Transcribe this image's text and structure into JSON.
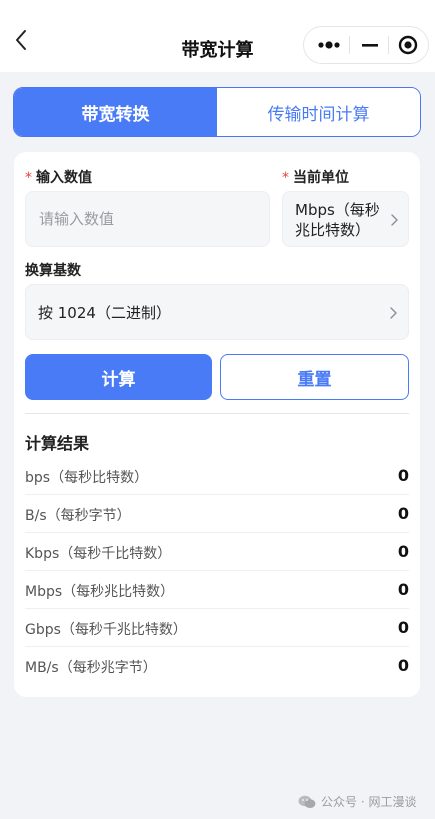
{
  "nav": {
    "title": "带宽计算",
    "back_icon": "chevron-left-icon",
    "capsule": {
      "more_icon": "more-dots-icon",
      "minimize_icon": "minimize-icon",
      "close_icon": "target-icon"
    }
  },
  "tabs": [
    {
      "label": "带宽转换",
      "active": true
    },
    {
      "label": "传输时间计算",
      "active": false
    }
  ],
  "form": {
    "value_field": {
      "required_mark": "*",
      "label": "输入数值",
      "placeholder": "请输入数值",
      "value": ""
    },
    "unit_field": {
      "required_mark": "*",
      "label": "当前单位",
      "selected": "Mbps（每秒兆比特数）"
    },
    "base_field": {
      "label": "换算基数",
      "selected": "按 1024（二进制）"
    }
  },
  "actions": {
    "calculate": "计算",
    "reset": "重置"
  },
  "results": {
    "title": "计算结果",
    "rows": [
      {
        "label": "bps（每秒比特数）",
        "value": "0"
      },
      {
        "label": "B/s（每秒字节）",
        "value": "0"
      },
      {
        "label": "Kbps（每秒千比特数）",
        "value": "0"
      },
      {
        "label": "Mbps（每秒兆比特数）",
        "value": "0"
      },
      {
        "label": "Gbps（每秒千兆比特数）",
        "value": "0"
      },
      {
        "label": "MB/s（每秒兆字节）",
        "value": "0"
      }
    ]
  },
  "watermark": {
    "text": "公众号 · 网工漫谈",
    "icon": "wechat-icon"
  },
  "colors": {
    "accent": "#4a7bf7",
    "required": "#e8433f",
    "background": "#f2f3f7"
  }
}
